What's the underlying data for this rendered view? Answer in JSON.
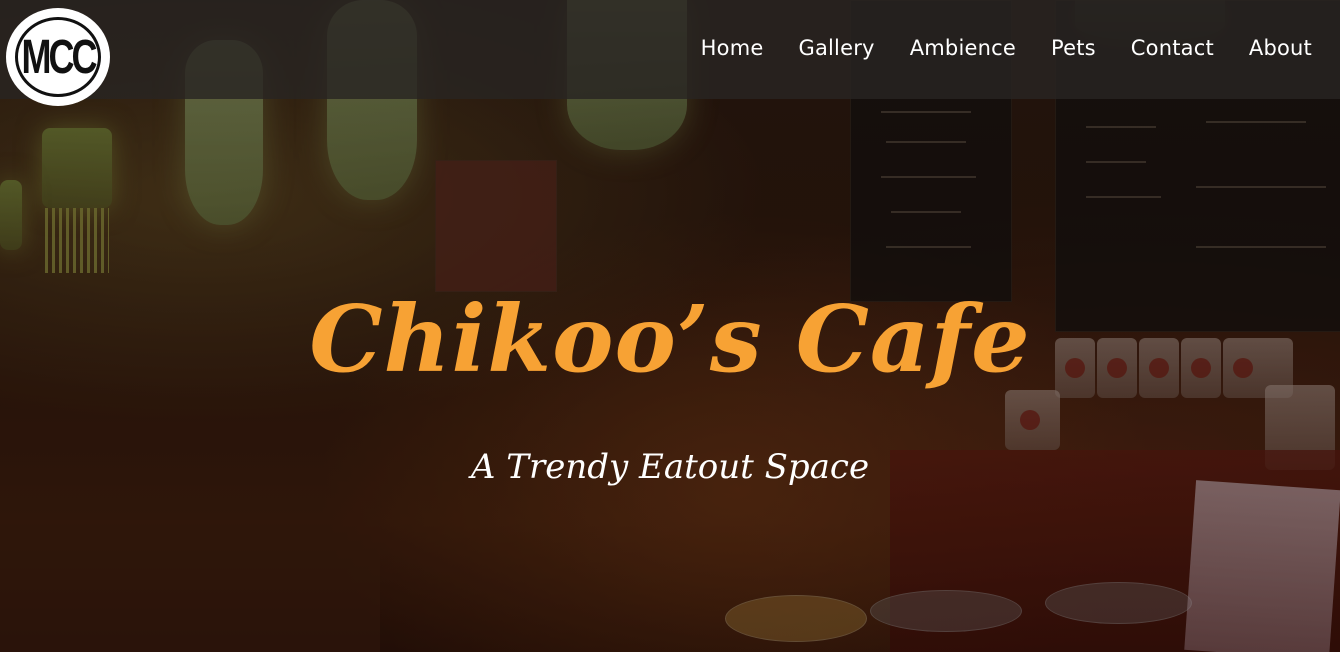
{
  "brand": {
    "logo_text": "MCC"
  },
  "nav": {
    "items": [
      {
        "label": "Home"
      },
      {
        "label": "Gallery"
      },
      {
        "label": "Ambience"
      },
      {
        "label": "Pets"
      },
      {
        "label": "Contact"
      },
      {
        "label": "About"
      }
    ]
  },
  "hero": {
    "title": "Chikoo’s Cafe",
    "subtitle": "A Trendy Eatout Space"
  },
  "colors": {
    "title": "#f7a234",
    "subtitle": "#ffffff",
    "nav_background": "#282422",
    "nav_text": "#ffffff",
    "logo_background": "#ffffff"
  }
}
